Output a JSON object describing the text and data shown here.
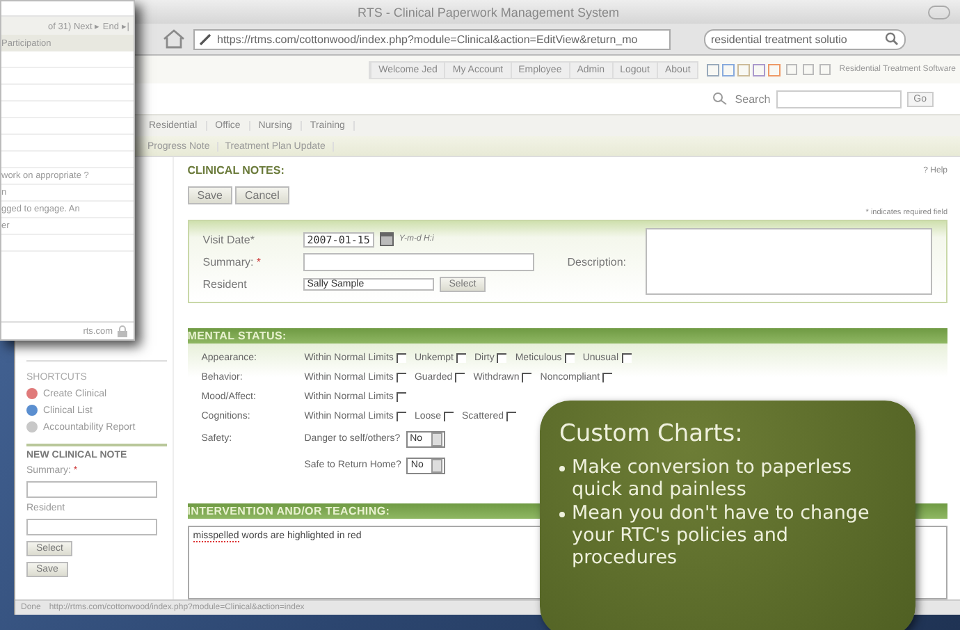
{
  "browser": {
    "title": "RTS - Clinical Paperwork Management System",
    "url": "https://rtms.com/cottonwood/index.php?module=Clinical&action=EditView&return_mo",
    "search": "residential treatment solutio"
  },
  "nav": {
    "links": [
      "Welcome Jed",
      "My Account",
      "Employee",
      "Admin",
      "Logout",
      "About"
    ],
    "brand": "Residential Treatment Software",
    "search_label": "Search",
    "go": "Go"
  },
  "tabs": [
    "Residential",
    "Office",
    "Nursing",
    "Training"
  ],
  "subtabs": [
    "Progress Note",
    "Treatment Plan Update"
  ],
  "popup": {
    "pager": "of 31)  Next ▸  End ▸|",
    "column": "Participation",
    "lines": [
      "work on appropriate ?",
      "n",
      "gged to engage. An",
      "er"
    ],
    "footer": "rts.com"
  },
  "sidebar": {
    "shortcuts_title": "SHORTCUTS",
    "shortcuts": [
      {
        "label": "Create Clinical",
        "color": "#e07a7a"
      },
      {
        "label": "Clinical List",
        "color": "#5b8fd0"
      },
      {
        "label": "Accountability Report",
        "color": "#c8c8c8"
      }
    ],
    "new_note": {
      "title": "NEW CLINICAL NOTE",
      "summary_label": "Summary:",
      "summary_mark": "*",
      "resident_label": "Resident",
      "select": "Select",
      "save": "Save"
    }
  },
  "clinical": {
    "title": "CLINICAL NOTES:",
    "help": "? Help",
    "buttons": [
      "Save",
      "Cancel"
    ],
    "required_note": "* indicates required field",
    "visit_date_label": "Visit Date*",
    "visit_date": "2007-01-15",
    "date_format": "Y-m-d H:i",
    "summary_label": "Summary:",
    "summary_mark": "*",
    "resident_label": "Resident",
    "resident": "Sally Sample",
    "select": "Select",
    "description_label": "Description:"
  },
  "mental_status": {
    "title": "MENTAL STATUS:",
    "rows": [
      {
        "kind": "checks",
        "label": "Appearance:",
        "options": [
          {
            "label": "Within Normal Limits",
            "checked": false
          },
          {
            "label": "Unkempt",
            "checked": false
          },
          {
            "label": "Dirty",
            "checked": false
          },
          {
            "label": "Meticulous",
            "checked": false
          },
          {
            "label": "Unusual",
            "checked": false
          }
        ]
      },
      {
        "kind": "checks",
        "label": "Behavior:",
        "options": [
          {
            "label": "Within Normal Limits",
            "checked": false
          },
          {
            "label": "Guarded",
            "checked": false
          },
          {
            "label": "Withdrawn",
            "checked": false
          },
          {
            "label": "Noncompliant",
            "checked": false
          }
        ]
      },
      {
        "kind": "checks",
        "label": "Mood/Affect:",
        "options": [
          {
            "label": "Within Normal Limits",
            "checked": false
          }
        ]
      },
      {
        "kind": "checks",
        "label": "Cognitions:",
        "options": [
          {
            "label": "Within Normal Limits",
            "checked": false
          },
          {
            "label": "Loose",
            "checked": false
          },
          {
            "label": "Scattered",
            "checked": false
          }
        ]
      },
      {
        "kind": "select",
        "label": "Safety:",
        "question": "Danger to self/others?",
        "value": "No"
      },
      {
        "kind": "select",
        "question": "Safe to Return Home?",
        "value": "No"
      }
    ]
  },
  "intervention": {
    "title": "INTERVENTION AND/OR TEACHING:",
    "words": [
      {
        "text": "misspelled",
        "misspelled": true
      },
      {
        "text": "words are highlighted in red",
        "misspelled": false
      }
    ]
  },
  "status_bar": {
    "state": "Done",
    "url": "http://rtms.com/cottonwood/index.php?module=Clinical&action=index"
  },
  "callout": {
    "title": "Custom Charts:",
    "bullets": [
      "Make conversion to paperless quick and painless",
      "Mean you don't have to change  your RTC's policies and procedures"
    ]
  }
}
